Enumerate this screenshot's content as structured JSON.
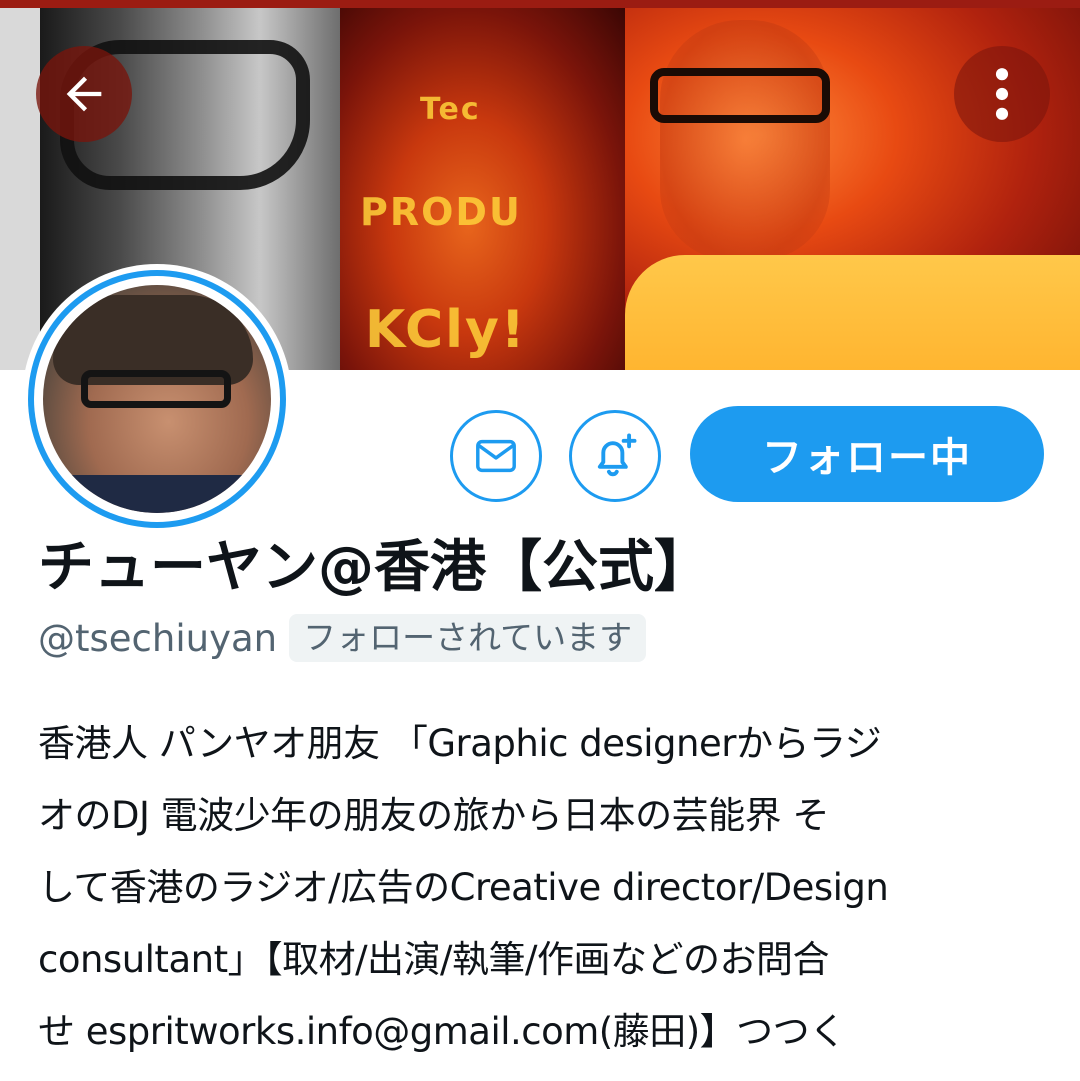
{
  "header": {
    "back_icon": "arrow-left-icon",
    "more_icon": "vertical-dots-icon",
    "banner_texts": [
      "PRODU",
      "KCly!",
      "Tec"
    ]
  },
  "profile": {
    "display_name": "チューヤン@香港【公式】",
    "handle": "@tsechiuyan",
    "follows_you_label": "フォローされています",
    "avatar_icon": "profile-photo"
  },
  "actions": {
    "message_icon": "mail-icon",
    "notify_icon": "bell-plus-icon",
    "follow_label": "フォロー中"
  },
  "bio": {
    "lines": [
      "香港人 パンヤオ朋友 「Graphic designerからラジ",
      "オのDJ 電波少年の朋友の旅から日本の芸能界 そ",
      "して香港のラジオ/広告のCreative director/Design",
      "consultant」【取材/出演/執筆/作画などのお問合",
      "せ espritworks.info@gmail.com(藤田)】つつく"
    ]
  },
  "colors": {
    "accent": "#1d9bf0",
    "text_primary": "#0f1419",
    "text_secondary": "#536471",
    "badge_bg": "#eff3f4"
  }
}
